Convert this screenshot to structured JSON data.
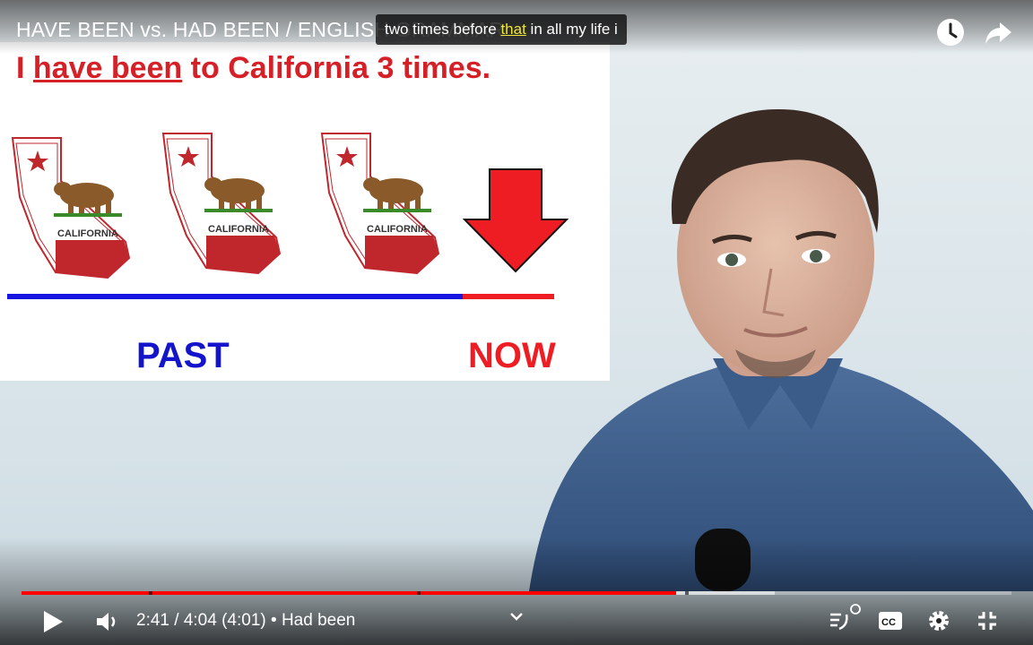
{
  "video": {
    "title": "HAVE BEEN vs. HAD BEEN / ENGLISH GRAMMAR",
    "caption": {
      "before": "two times before ",
      "highlight": "that",
      "after": "  in all my life i"
    }
  },
  "slide": {
    "heading_pre": "I ",
    "heading_underlined": "have been",
    "heading_post": " to California 3 times.",
    "state_label": "CALIFORNIA",
    "past_label": "PAST",
    "now_label": "NOW"
  },
  "controls": {
    "time_current": "2:41",
    "time_separator": " / ",
    "time_total": "4:04",
    "time_adjusted": "(4:01)",
    "chapter_bullet": " • ",
    "chapter": "Had been",
    "progress": 0.661
  },
  "icons": [
    "watch-later-icon",
    "share-icon",
    "play-icon",
    "volume-icon",
    "chevron-down-icon",
    "autoplay-icon",
    "captions-icon",
    "settings-icon",
    "exit-fullscreen-icon"
  ],
  "colors": {
    "progress_played": "#ff0000",
    "slide_red": "#d52027",
    "slide_blue": "#1414cc"
  }
}
